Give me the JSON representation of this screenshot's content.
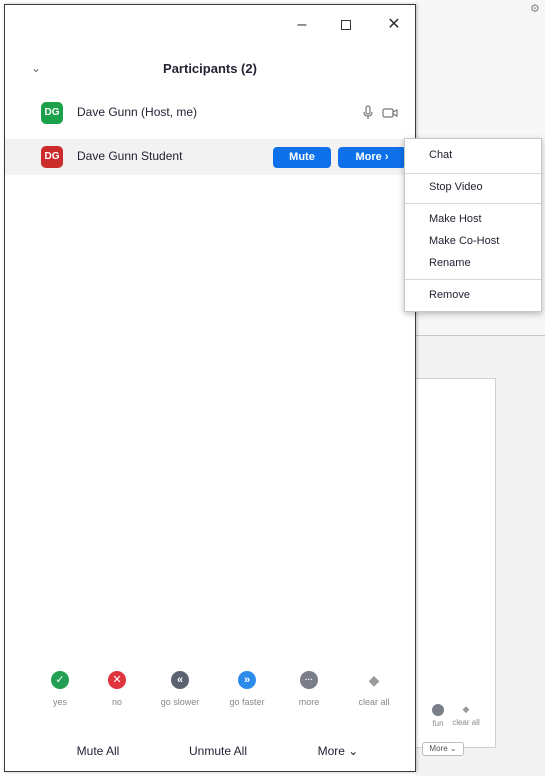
{
  "window": {
    "minimize_label": "–",
    "close_label": "✕"
  },
  "panel": {
    "title": "Participants (2)",
    "collapse_icon": "chevron-down-icon"
  },
  "participants": [
    {
      "initials": "DG",
      "name": "Dave Gunn (Host, me)",
      "avatar_color": "#1aa14a"
    },
    {
      "initials": "DG",
      "name": "Dave Gunn Student",
      "avatar_color": "#cc2b2b",
      "mute_label": "Mute",
      "more_label": "More ›"
    }
  ],
  "context_menu": {
    "items": [
      "Chat",
      "Stop Video",
      "Make Host",
      "Make Co-Host",
      "Rename",
      "Remove"
    ]
  },
  "reactions": [
    {
      "label": "yes",
      "glyph": "✓",
      "color": "#21a052"
    },
    {
      "label": "no",
      "glyph": "✕",
      "color": "#e0343c"
    },
    {
      "label": "go slower",
      "glyph": "«",
      "color": "#5d6270"
    },
    {
      "label": "go faster",
      "glyph": "»",
      "color": "#2d8ceb"
    },
    {
      "label": "more",
      "glyph": "···",
      "color": "#7a7e88"
    },
    {
      "label": "clear all",
      "glyph": "◆",
      "color": "#b8b8b8"
    }
  ],
  "footer": {
    "mute_all": "Mute All",
    "unmute_all": "Unmute All",
    "more": "More ⌄"
  },
  "background_app": {
    "reaction_labels": [
      "fun",
      "clear all"
    ],
    "more_label": "More ⌄"
  },
  "colors": {
    "accent_blue": "#0e71eb",
    "host_avatar": "#1aa14a",
    "student_avatar": "#cc2b2b"
  }
}
